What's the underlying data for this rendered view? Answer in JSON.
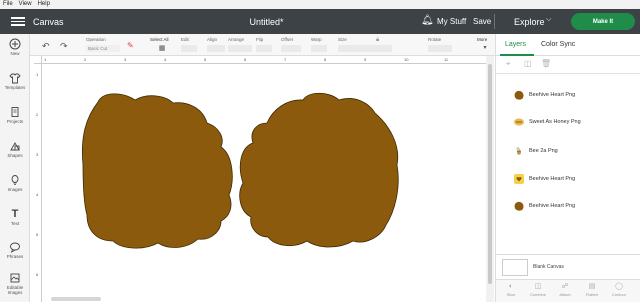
{
  "menubar": {
    "items": [
      "File",
      "View",
      "Help"
    ]
  },
  "topbar": {
    "app_title": "Canvas",
    "doc_title": "Untitled*",
    "my_stuff": "My Stuff",
    "save": "Save",
    "explore": "Explore",
    "make_it": "Make It"
  },
  "left_panel": {
    "items": [
      {
        "label": "New",
        "icon": "plus-icon"
      },
      {
        "label": "Templates",
        "icon": "shirt-icon"
      },
      {
        "label": "Projects",
        "icon": "projects-icon"
      },
      {
        "label": "Shapes",
        "icon": "shapes-icon"
      },
      {
        "label": "Images",
        "icon": "lightbulb-icon"
      },
      {
        "label": "Text",
        "icon": "text-icon"
      },
      {
        "label": "Phrases",
        "icon": "speech-bubble-icon"
      },
      {
        "label": "Editable Images",
        "icon": "editable-images-icon"
      }
    ]
  },
  "toolbar": {
    "operation_label": "Operation",
    "operation_value": "Basic Cut",
    "select_all": "Select All",
    "edit": "Edit",
    "align": "Align",
    "arrange": "Arrange",
    "flip": "Flip",
    "offset": "Offset",
    "warp": "Warp",
    "size": "Size",
    "rotate": "Rotate",
    "more": "More"
  },
  "ruler": {
    "top_ticks": [
      "1",
      "2",
      "3",
      "4",
      "5",
      "6",
      "7",
      "8",
      "9",
      "10",
      "11"
    ],
    "left_ticks": [
      "1",
      "2",
      "3",
      "4",
      "5",
      "6"
    ]
  },
  "canvas": {
    "shape_fill": "#8b5a0c",
    "shape_stroke": "#3e2a06"
  },
  "right_panel": {
    "tab_layers": "Layers",
    "tab_color_sync": "Color Sync",
    "layers": [
      {
        "name": "Beehive Heart Png",
        "thumb": "brown-blob"
      },
      {
        "name": "Sweet As Honey Png",
        "thumb": "honey-text"
      },
      {
        "name": "Bee 2a Png",
        "thumb": "bee"
      },
      {
        "name": "Beehive Heart Png",
        "thumb": "yellow-heart"
      },
      {
        "name": "Beehive Heart Png",
        "thumb": "brown-blob"
      }
    ],
    "blank_canvas": "Blank Canvas",
    "bottom_actions": [
      "Slice",
      "Combine",
      "Attach",
      "Flatten",
      "Contour"
    ]
  },
  "colors": {
    "topbar": "#3c4245",
    "accent": "#1f8c4a"
  }
}
